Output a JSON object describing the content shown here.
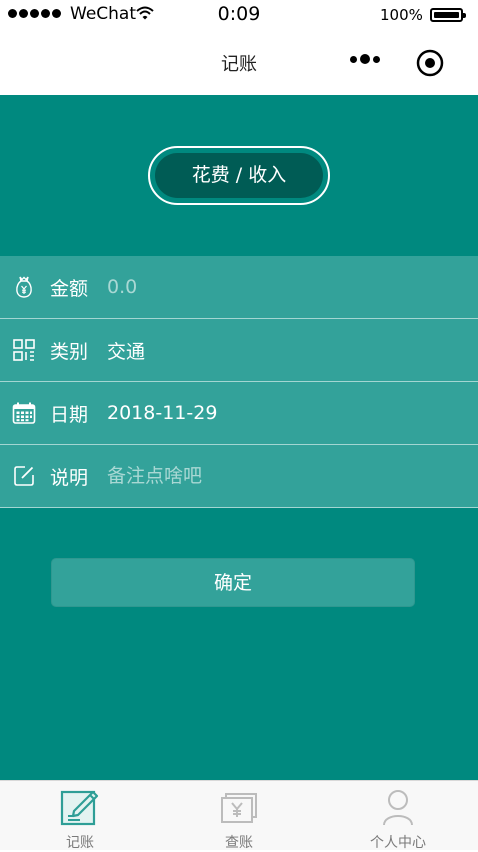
{
  "status_bar": {
    "carrier": "WeChat",
    "time": "0:09",
    "battery_percent": "100%"
  },
  "nav": {
    "title": "记账"
  },
  "toggle": {
    "label": "花费 / 收入"
  },
  "form": {
    "amount": {
      "icon": "money-bag-icon",
      "label": "金额",
      "placeholder": "0.0",
      "value": ""
    },
    "category": {
      "icon": "grid-icon",
      "label": "类别",
      "value": "交通"
    },
    "date": {
      "icon": "calendar-icon",
      "label": "日期",
      "value": "2018-11-29"
    },
    "note": {
      "icon": "edit-icon",
      "label": "说明",
      "placeholder": "备注点啥吧",
      "value": ""
    }
  },
  "confirm_label": "确定",
  "tabs": [
    {
      "label": "记账",
      "icon": "edit-note-icon",
      "active": true
    },
    {
      "label": "查账",
      "icon": "yen-bill-icon",
      "active": false
    },
    {
      "label": "个人中心",
      "icon": "person-icon",
      "active": false
    }
  ],
  "colors": {
    "primary": "#00897f",
    "row_background": "#33a29a",
    "toggle_fill": "#005c55",
    "tab_active": "#2e9e96",
    "tab_inactive": "#bcbcbc"
  }
}
